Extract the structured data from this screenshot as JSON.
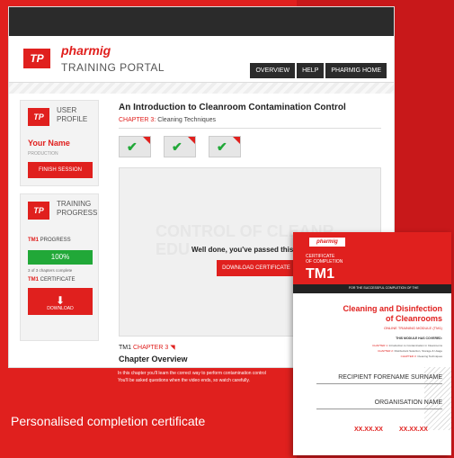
{
  "caption": "Personalised completion certificate",
  "header": {
    "tp_badge": "TP",
    "brand": "pharmig",
    "portal_title": "TRAINING PORTAL",
    "nav": [
      "OVERVIEW",
      "HELP",
      "PHARMIG HOME"
    ]
  },
  "sidebar": {
    "profile": {
      "icon_text": "TP",
      "title": "USER PROFILE",
      "name": "Your Name",
      "role": "PRODUCTION",
      "finish_label": "FINISH SESSION"
    },
    "progress": {
      "icon_text": "TP",
      "title": "TRAINING PROGRESS",
      "tm_code": "TM1",
      "progress_label": "PROGRESS",
      "progress_value": "100%",
      "chapters_complete": "3 of 3 chapters complete",
      "certificate_label": "CERTIFICATE",
      "download_label": "DOWNLOAD"
    }
  },
  "main": {
    "title": "An Introduction to Cleanroom Contamination Control",
    "chapter_label": "CHAPTER 3:",
    "chapter_name": "Cleaning Techniques",
    "video": {
      "ghost_text": "CONTROL OF CLEANR EDU",
      "done_text": "Well done, you've passed this ch",
      "download_certificate": "DOWNLOAD CERTIFICATE"
    },
    "footer": {
      "tm_code": "TM1",
      "chapter": "CHAPTER 3",
      "overview_title": "Chapter Overview",
      "desc_line1": "In this chapter you'll learn the correct way to perform contamination control",
      "desc_line2": "You'll be asked questions when the video ends, so watch carefully."
    }
  },
  "certificate": {
    "logo": "pharmig",
    "subtitle_line1": "CERTIFICATE",
    "subtitle_line2": "OF COMPLETION",
    "code": "TM1",
    "band_text": "FOR THE SUCCESSFUL COMPLETION OF THE",
    "heading_line1": "Cleaning and Disinfection",
    "heading_line2": "of Cleanrooms",
    "module": "ONLINE TRAINING MODULE (TM1)",
    "covered": "THIS MODULE HAS COVERED:",
    "chapters": [
      {
        "label": "CHAPTER 1:",
        "text": "Introduction to Contamination in Cleanrooms"
      },
      {
        "label": "CHAPTER 2:",
        "text": "Disinfectant Selection, Storage & Usage"
      },
      {
        "label": "CHAPTER 3:",
        "text": "Cleaning Techniques"
      }
    ],
    "recipient": "RECIPIENT FORENAME SURNAME",
    "organisation": "ORGANISATION NAME",
    "date1": "XX.XX.XX",
    "date2": "XX.XX.XX"
  }
}
